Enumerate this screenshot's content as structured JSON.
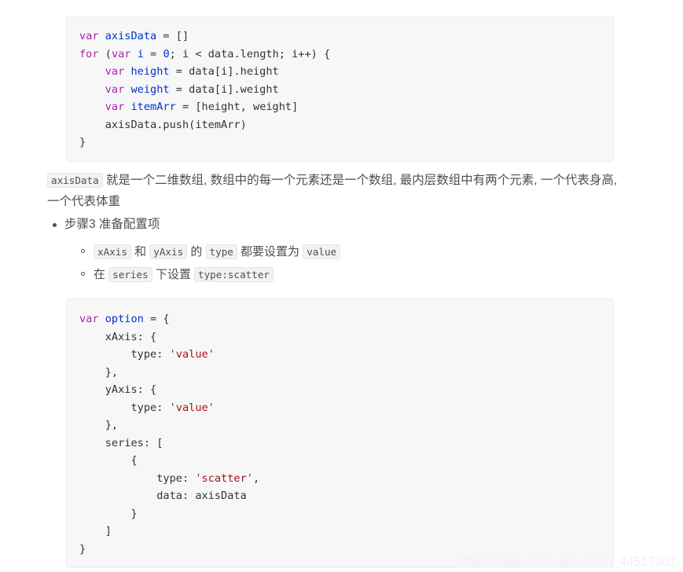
{
  "code_block_1": {
    "language": "javascript",
    "lines": [
      [
        {
          "t": "var ",
          "c": "k"
        },
        {
          "t": "axisData",
          "c": "id"
        },
        {
          "t": " = []",
          "c": "p"
        }
      ],
      [
        {
          "t": "for ",
          "c": "k"
        },
        {
          "t": "(",
          "c": "p"
        },
        {
          "t": "var ",
          "c": "k"
        },
        {
          "t": "i",
          "c": "id"
        },
        {
          "t": " = ",
          "c": "p"
        },
        {
          "t": "0",
          "c": "num"
        },
        {
          "t": "; i < data.length; i++) {",
          "c": "p"
        }
      ],
      [
        {
          "t": "    ",
          "c": "p"
        },
        {
          "t": "var ",
          "c": "k"
        },
        {
          "t": "height",
          "c": "id"
        },
        {
          "t": " = data[i].height",
          "c": "p"
        }
      ],
      [
        {
          "t": "    ",
          "c": "p"
        },
        {
          "t": "var ",
          "c": "k"
        },
        {
          "t": "weight",
          "c": "id"
        },
        {
          "t": " = data[i].weight",
          "c": "p"
        }
      ],
      [
        {
          "t": "    ",
          "c": "p"
        },
        {
          "t": "var ",
          "c": "k"
        },
        {
          "t": "itemArr",
          "c": "id"
        },
        {
          "t": " = [height, weight]",
          "c": "p"
        }
      ],
      [
        {
          "t": "    axisData.push(itemArr)",
          "c": "p"
        }
      ],
      [
        {
          "t": "}",
          "c": "p"
        }
      ]
    ]
  },
  "paragraph_1": {
    "parts": [
      {
        "t": "axisData",
        "code": true
      },
      {
        "t": " 就是一个二维数组, 数组中的每一个元素还是一个数组, 最内层数组中有两个元素, 一个代表身高, 一个代表体重",
        "code": false
      }
    ]
  },
  "list": {
    "item_label": "步骤3 准备配置项",
    "subitems": [
      {
        "parts": [
          {
            "t": "xAxis",
            "code": true
          },
          {
            "t": " 和 ",
            "code": false
          },
          {
            "t": "yAxis",
            "code": true
          },
          {
            "t": " 的 ",
            "code": false
          },
          {
            "t": "type",
            "code": true
          },
          {
            "t": " 都要设置为 ",
            "code": false
          },
          {
            "t": "value",
            "code": true
          }
        ]
      },
      {
        "parts": [
          {
            "t": "在 ",
            "code": false
          },
          {
            "t": "series",
            "code": true
          },
          {
            "t": " 下设置 ",
            "code": false
          },
          {
            "t": "type:scatter",
            "code": true
          }
        ]
      }
    ]
  },
  "code_block_2": {
    "language": "javascript",
    "lines": [
      [
        {
          "t": "var ",
          "c": "k"
        },
        {
          "t": "option",
          "c": "id"
        },
        {
          "t": " = {",
          "c": "p"
        }
      ],
      [
        {
          "t": "    xAxis: {",
          "c": "p"
        }
      ],
      [
        {
          "t": "        type: ",
          "c": "p"
        },
        {
          "t": "'value'",
          "c": "str"
        }
      ],
      [
        {
          "t": "    },",
          "c": "p"
        }
      ],
      [
        {
          "t": "    yAxis: {",
          "c": "p"
        }
      ],
      [
        {
          "t": "        type: ",
          "c": "p"
        },
        {
          "t": "'value'",
          "c": "str"
        }
      ],
      [
        {
          "t": "    },",
          "c": "p"
        }
      ],
      [
        {
          "t": "    series: [",
          "c": "p"
        }
      ],
      [
        {
          "t": "        {",
          "c": "p"
        }
      ],
      [
        {
          "t": "            type: ",
          "c": "p"
        },
        {
          "t": "'scatter'",
          "c": "str"
        },
        {
          "t": ",",
          "c": "p"
        }
      ],
      [
        {
          "t": "            data: axisData",
          "c": "p"
        }
      ],
      [
        {
          "t": "        }",
          "c": "p"
        }
      ],
      [
        {
          "t": "    ]",
          "c": "p"
        }
      ],
      [
        {
          "t": "}",
          "c": "p"
        }
      ]
    ]
  },
  "watermark": {
    "text": "https://blog.csdn.net/weixin_44517301"
  },
  "colors": {
    "background": "#ffffff",
    "code_background": "#f7f7f8",
    "code_border": "#eceef0",
    "text": "#4f4f4f",
    "keyword": "#a626a4",
    "identifier": "#0033cc",
    "string": "#a31515",
    "punctuation": "#333333",
    "inline_code_background": "#f2f2f3",
    "watermark": "#f0f0f0"
  }
}
